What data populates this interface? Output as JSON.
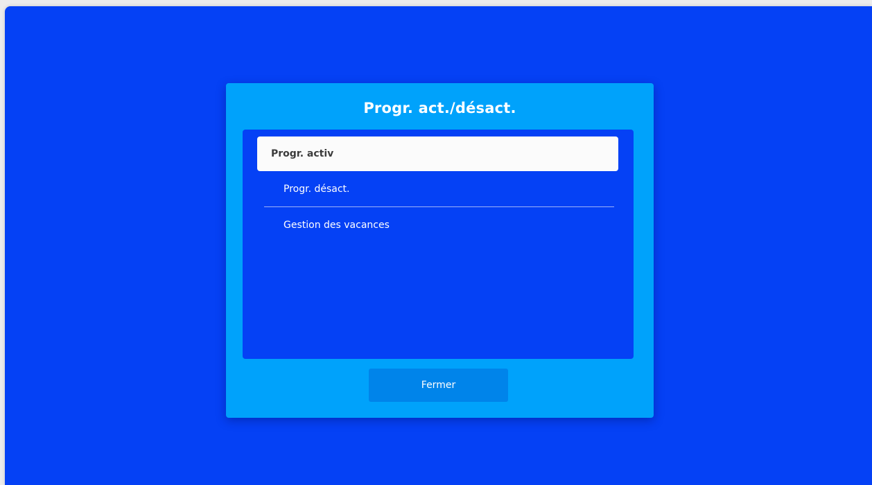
{
  "dialog": {
    "title": "Progr. act./désact.",
    "items": [
      {
        "label": "Progr. activ",
        "selected": true
      },
      {
        "label": "Progr. désact.",
        "selected": false
      },
      {
        "label": "Gestion des vacances",
        "selected": false
      }
    ],
    "close_label": "Fermer"
  },
  "colors": {
    "background": "#0541f5",
    "dialog": "#00a2fb",
    "button": "#0084ea",
    "selected_item": "#fbfbfb"
  }
}
